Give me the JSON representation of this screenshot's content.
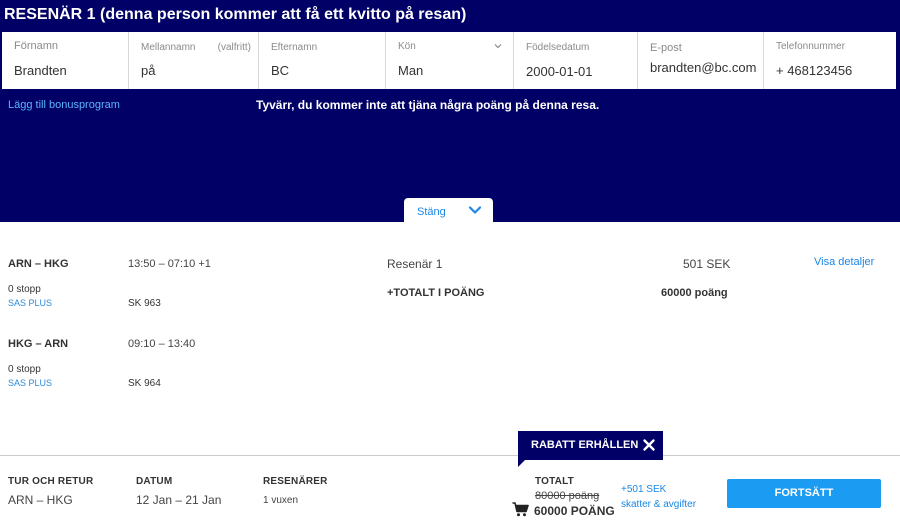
{
  "passenger": {
    "title": "RESENÄR 1 (denna person kommer att få ett kvitto på resan)",
    "fields": [
      {
        "label": "Förnamn",
        "value": "Brandten"
      },
      {
        "label": "Mellannamn",
        "extra": "(valfritt)",
        "value": "på"
      },
      {
        "label": "Efternamn",
        "value": "BC"
      },
      {
        "label": "Kön",
        "value": "Man"
      },
      {
        "label": "Födelsedatum",
        "value": "2000-01-01"
      },
      {
        "label": "E-post",
        "value": "brandten@bc.com"
      },
      {
        "label": "Telefonnummer",
        "value": "+ 468123456"
      }
    ],
    "bonus_link": "Lägg till bonusprogram",
    "points_message": "Tyvärr, du kommer inte att tjäna några poäng på denna resa.",
    "close_label": "Stäng"
  },
  "flights": [
    {
      "route": "ARN – HKG",
      "time": "13:50 – 07:10 +1",
      "stops": "0 stopp",
      "tier": "SAS PLUS",
      "flight_no": "SK 963"
    },
    {
      "route": "HKG – ARN",
      "time": "09:10 – 13:40",
      "stops": "0 stopp",
      "tier": "SAS PLUS",
      "flight_no": "SK 964"
    }
  ],
  "price_summary": {
    "passenger_label": "Resenär 1",
    "passenger_price": "501 SEK",
    "details_link": "Visa detaljer",
    "total_points_label": "+TOTALT I POÄNG",
    "total_points_value": "60000 poäng"
  },
  "footer": {
    "discount_badge": "RABATT ERHÅLLEN",
    "trip_label": "TUR OCH RETUR",
    "trip_value": "ARN – HKG",
    "date_label": "DATUM",
    "date_value": "12 Jan – 21 Jan",
    "travellers_label": "RESENÄRER",
    "travellers_value": "1 vuxen",
    "total_label": "TOTALT",
    "original_points": "80000 poäng",
    "final_points": "60000 POÄNG",
    "fee_amount": "+501 SEK",
    "fee_label": "skatter & avgifter",
    "continue_label": "FORTSÄTT"
  },
  "colors": {
    "header_bg": "#000066",
    "accent": "#1b9cf2",
    "link": "#1b87e6"
  }
}
